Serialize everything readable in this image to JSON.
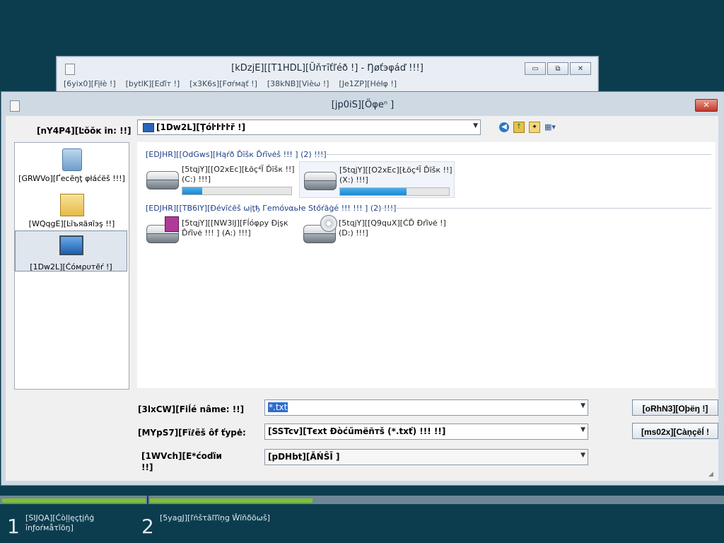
{
  "notepad": {
    "title": "[kDzjE][[T1HDL][Ŭňтīťľéð !] - Ŋøťэφáď !!!]",
    "menu": [
      "[6yix0][Fįłè !]",
      "[bytlK][Eďīт !]",
      "[x3K6s][Fσŕмąť !]",
      "[38kNB][Vièω !]",
      "[Je1ZP][Hėłφ !]"
    ],
    "buttons": [
      "▭",
      "⧉",
      "✕"
    ]
  },
  "dialog": {
    "title": "[jp0iS][Öφeⁿ ]",
    "close_label": "✕",
    "look_in_label": "[nY4P4][Ŀŏŏĸ in: !!]",
    "look_in_value": "[1Dw2L][Ţóŀŀŀŀř !]",
    "toolbar": {
      "back": "◀",
      "up": "↑",
      "new_folder": "✦",
      "view": "▦▾"
    },
    "places": [
      {
        "label": "[GRWVo][Ґесēŋţ φłáćёš !!!]",
        "icon": "recent-places-icon",
        "selected": false
      },
      {
        "label": "[WQqgE][Ŀīъяäяīэş !!]",
        "icon": "libraries-icon",
        "selected": false
      },
      {
        "label": "[1Dw2L][Ćóмρυтēŕ !]",
        "icon": "computer-icon",
        "selected": true
      }
    ],
    "groups": [
      {
        "header": "[EDJHR][[OdGws][Нąŕð Ďīšк Ďŕīνėš !!! ] (2) !!!]",
        "items": [
          {
            "line1": "[5tqjY][[O2xEc][Łōç⁴Ĩ Ďīšк !!]",
            "line2": "(C:) !!!]",
            "fill": 0.18,
            "highlight": false,
            "kind": "hdd"
          },
          {
            "line1": "[5tqjY][[O2xEc][Łōç⁴Ĩ Ďīšк !!]",
            "line2": "(X:) !!!]",
            "fill": 0.61,
            "highlight": true,
            "kind": "hdd"
          }
        ]
      },
      {
        "header": "[EDJHR][[TB6lY][Ðévīċēš ωįţђ Геmόναьŀе Stőŕāġé !!! !!! ] (2) !!!]",
        "items": [
          {
            "line1": "[5tqjY][[NW3lJ][Fĺόφρу Ðįşк",
            "line2": "Ďŕīνė !!! ] (A:) !!!]",
            "kind": "floppy"
          },
          {
            "line1": "[5tqjY][[Q9quX][ĆĎ Ðŕīνė !]",
            "line2": "(D:) !!!]",
            "kind": "cd"
          }
        ]
      }
    ],
    "file_name_label": "[3lxCW][Fiĺé nâme: !!]",
    "file_name_value": "*.txt",
    "file_type_label": "[MYpS7][Fïℓёš ôf ťурė:",
    "file_type_value": "[SSTcv][Тєхt Ðòćűmëñтš (*.txť) !!! !!]",
    "encoding_label": "[1WVch][E*ćoďïи !!]",
    "encoding_value": "[pDHbt][ĂŃŜĪ ]",
    "open_button": "[oRhN3][Oþëŋ !]",
    "cancel_button": "[ms02x][Càņçēĺ !"
  },
  "setup": {
    "steps": [
      {
        "num": "1",
        "label": "[SIJQA][Ćòļļęçţįňģ ĭnƒоŕмåτĩōŋ]"
      },
      {
        "num": "2",
        "label": "[5yagJ][ľńšτāľľïņg Ŵïňδōωš]"
      }
    ]
  }
}
